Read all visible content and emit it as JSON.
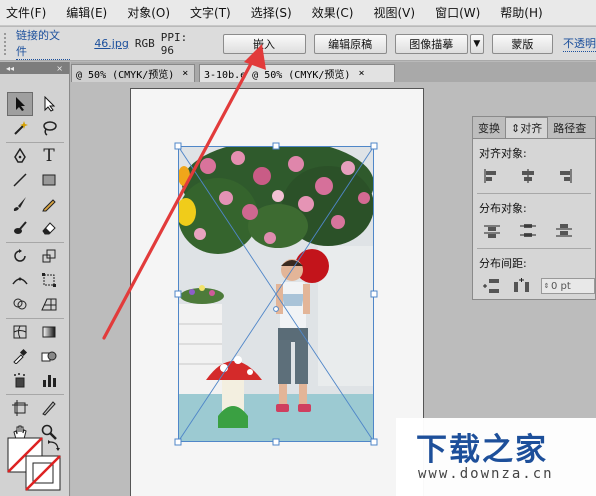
{
  "menu": [
    "文件(F)",
    "编辑(E)",
    "对象(O)",
    "文字(T)",
    "选择(S)",
    "效果(C)",
    "视图(V)",
    "窗口(W)",
    "帮助(H)"
  ],
  "control": {
    "linked_file_label": "链接的文件",
    "filename": "46.jpg",
    "color_mode": "RGB",
    "ppi": "PPI: 96",
    "embed_button": "嵌入",
    "edit_original_button": "编辑原稿",
    "image_trace_button": "图像描摹",
    "mask_button": "蒙版",
    "opacity_label": "不透明"
  },
  "tabs": [
    {
      "label": "@ 50% (CMYK/预览)",
      "close": "×"
    },
    {
      "label": "3-10b.e  @ 50% (CMYK/预览)",
      "close": "×"
    }
  ],
  "toolbar": {
    "collapse": "◂◂",
    "close": "×"
  },
  "panel": {
    "tabs": [
      "变换",
      "对齐",
      "路径查"
    ],
    "align_objects": "对齐对象:",
    "distribute_objects": "分布对象:",
    "distribute_spacing": "分布间距:",
    "spacing_value": "0 pt"
  },
  "watermark": {
    "title": "下载之家",
    "url": "www.downza.cn"
  },
  "colors": {
    "arrow": "#e23b3b",
    "link_text": "#1b4f9c",
    "watermark": "#1d4f9a"
  }
}
